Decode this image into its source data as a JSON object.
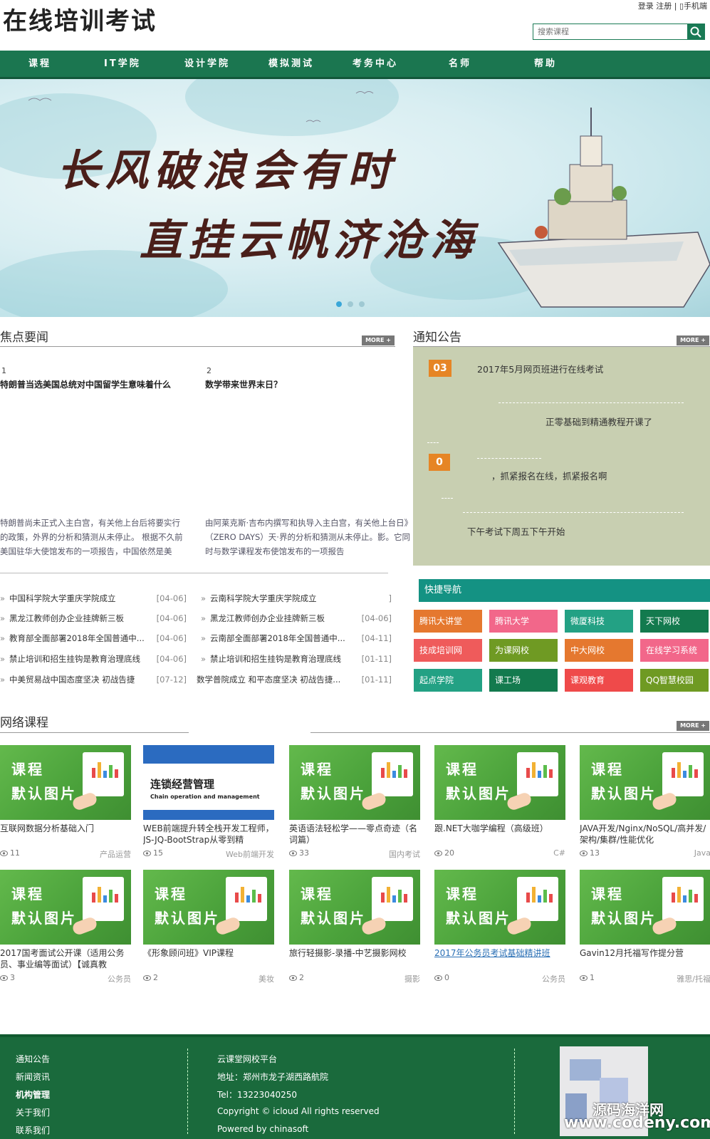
{
  "header": {
    "logo": "在线培训考试",
    "top_links": "登录 注册 | ▯手机端",
    "search_placeholder": "搜索课程"
  },
  "nav": {
    "items": [
      "课程",
      "IT学院",
      "设计学院",
      "模拟测试",
      "考务中心",
      "名师",
      "帮助"
    ]
  },
  "banner": {
    "line1": "长风破浪会有时",
    "line2": "直挂云帆济沧海"
  },
  "focus": {
    "title": "焦点要闻",
    "more": "MORE +",
    "left_img_alt": "1",
    "left_title": "特朗普当选美国总统对中国留学生意味着什么",
    "left_desc": "特朗普尚未正式入主白宫，有关他上台后将要实行的政策，外界的分析和猜测从未停止。 根据不久前美国驻华大使馆发布的一项报告，中国依然是美",
    "right_img_alt": "2",
    "right_title": "数学带来世界末日？",
    "right_desc": "由阿莱克斯·吉布内撰写和执导入主白宫，有关他上台日》（ZERO DAYS）天·界的分析和猜测从未停止。影。它同时与数学课程发布使馆发布的一项报告",
    "list_left": [
      {
        "text": "中国科学院大学重庆学院成立",
        "date": "[04-06]"
      },
      {
        "text": "黑龙江教师创办企业挂牌新三板",
        "date": "[04-06]"
      },
      {
        "text": "教育部全面部署2018年全国普通中...",
        "date": "[04-06]"
      },
      {
        "text": "禁止培训和招生挂钩是教育治理底线",
        "date": "[04-06]"
      },
      {
        "text": "中美贸易战中国态度坚决 初战告捷",
        "date": "[07-12]"
      }
    ],
    "list_right": [
      {
        "text": "云南科学院大学重庆学院成立",
        "date": "]"
      },
      {
        "text": "黑龙江教师创办企业挂牌新三板",
        "date": "[04-06]"
      },
      {
        "text": "云南部全面部署2018年全国普通中...",
        "date": "[04-11]"
      },
      {
        "text": "禁止培训和招生挂钩是教育治理底线",
        "date": "[01-11]"
      },
      {
        "text": "数学普院成立 和平态度坚决 初战告捷...",
        "date": "[01-11]"
      }
    ]
  },
  "notice": {
    "title": "通知公告",
    "more": "MORE +",
    "items": [
      {
        "badge": "03",
        "text": "2017年5月网页班进行在线考试"
      },
      {
        "badge": "",
        "text": "正零基础到精通教程开课了"
      },
      {
        "badge": "0",
        "text": "，抓紧报名在线，抓紧报名啊"
      },
      {
        "badge": "",
        "text": "下午考试下周五下午开始"
      }
    ]
  },
  "quick": {
    "title": "快捷导航",
    "buttons": [
      {
        "label": "腾讯大讲堂",
        "color": "#e5782f"
      },
      {
        "label": "腾讯大学",
        "color": "#f2678a"
      },
      {
        "label": "微厦科技",
        "color": "#23a184"
      },
      {
        "label": "天下网校",
        "color": "#137a4e"
      },
      {
        "label": "技成培训网",
        "color": "#ef5b5b"
      },
      {
        "label": "为课网校",
        "color": "#6f9a23"
      },
      {
        "label": "中大网校",
        "color": "#e5782f"
      },
      {
        "label": "在线学习系统",
        "color": "#f2678a"
      },
      {
        "label": "起点学院",
        "color": "#23a184"
      },
      {
        "label": "课工场",
        "color": "#137a4e"
      },
      {
        "label": "课观教育",
        "color": "#ef4a4a"
      },
      {
        "label": "QQ智慧校园",
        "color": "#6f9a23"
      }
    ]
  },
  "courses": {
    "title": "网络课程",
    "more": "MORE +",
    "thumb_line1": "课程",
    "thumb_line2": "默认图片",
    "alt_thumb_cn": "连锁经营管理",
    "alt_thumb_en": "Chain operation and management",
    "items": [
      {
        "title": "互联网数据分析基础入门",
        "views": "11",
        "cat": "产品运营"
      },
      {
        "title": "WEB前端提升转全栈开发工程师，JS-JQ-BootStrap从零到精",
        "views": "15",
        "cat": "Web前端开发"
      },
      {
        "title": "英语语法轻松学——零点奇迹（名词篇）",
        "views": "33",
        "cat": "国内考试"
      },
      {
        "title": "跟.NET大咖学编程（高级班）",
        "views": "20",
        "cat": "C#"
      },
      {
        "title": "JAVA开发/Nginx/NoSQL/高并发/架构/集群/性能优化",
        "views": "13",
        "cat": "Java"
      },
      {
        "title": "2017国考面试公开课（适用公务员、事业编等面试）【诚真教",
        "views": "3",
        "cat": "公务员"
      },
      {
        "title": "《形象顾问班》VIP课程",
        "views": "2",
        "cat": "美妆"
      },
      {
        "title": "旅行轻摄影-录播-中艺摄影网校",
        "views": "2",
        "cat": "摄影"
      },
      {
        "title": "2017年公务员考试基础精讲班",
        "views": "0",
        "cat": "公务员"
      },
      {
        "title": "Gavin12月托福写作提分营",
        "views": "1",
        "cat": "雅思/托福"
      }
    ]
  },
  "footer": {
    "links": [
      "通知公告",
      "新闻资讯",
      "机构管理",
      "关于我们",
      "联系我们"
    ],
    "info": [
      "云课堂网校平台",
      "地址：郑州市龙子湖西路航院",
      "Tel：13223040250",
      "Copyright © icloud All rights reserved",
      "Powered by chinasoft"
    ],
    "watermark1": "源码海洋网",
    "watermark2": "www.codeny.com"
  },
  "colors": {
    "brand_green": "#1b7650",
    "notice_bg": "#c8cfb1",
    "quick_head": "#149283",
    "badge_orange": "#e68525"
  }
}
